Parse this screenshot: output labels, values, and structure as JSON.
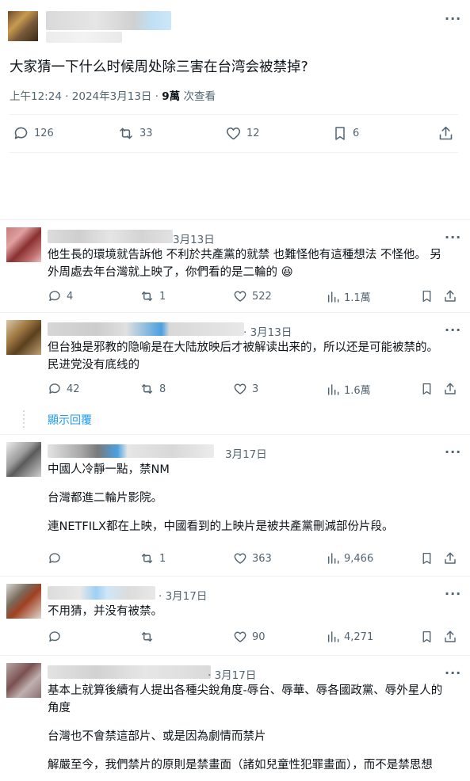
{
  "main_post": {
    "text": "大家猜一下什么时候周处除三害在台湾会被禁掉?",
    "meta_time": "上午12:24 · 2024年3月13日 · ",
    "views": "9萬",
    "views_label": " 次查看",
    "actions": {
      "replies": "126",
      "reposts": "33",
      "likes": "12",
      "bookmarks": "6"
    }
  },
  "replies": [
    {
      "date": "3月13日",
      "text_lines": [
        "他生長的環境就告訴他 不利於共產黨的就禁 也難怪他有這種想法 不怪他。 另",
        "外周處去年台灣就上映了，你們看的是二輪的 😆"
      ],
      "replies": "4",
      "reposts": "1",
      "likes": "522",
      "views": "1.1萬"
    },
    {
      "date": "· 3月13日",
      "text_lines": [
        "但台独是邪教的隐喻是在大陆放映后才被解读出来的，所以还是可能被禁的。",
        "民进党没有底线的"
      ],
      "replies": "42",
      "reposts": "8",
      "likes": "3",
      "views": "1.6萬"
    },
    {
      "show_replies": "顯示回覆"
    },
    {
      "date": "3月17日",
      "text_lines": [
        "中國人冷靜一點，禁NM",
        "",
        "台灣都進二輪片影院。",
        "",
        "連NETFILX都在上映，中國看到的上映片是被共產黨刪減部份片段。"
      ],
      "replies": "",
      "reposts": "1",
      "likes": "363",
      "views": "9,466"
    },
    {
      "date": "· 3月17日",
      "text_lines": [
        "不用猜，并没有被禁。"
      ],
      "replies": "",
      "reposts": "",
      "likes": "90",
      "views": "4,271"
    },
    {
      "date": "· 3月17日",
      "text_lines": [
        "基本上就算後續有人提出各種尖銳角度-辱台、辱華、辱各國政黨、辱外星人的",
        "角度",
        "",
        "台灣也不會禁這部片、或是因為劇情而禁片",
        "",
        "解嚴至今，我們禁片的原則是禁畫面（諸如兒童性犯罪畫面），而不是禁思想"
      ]
    }
  ],
  "colors": {
    "text": "#0f1419",
    "muted": "#536471",
    "link": "#1d9bf0",
    "divider": "#eff3f4"
  }
}
